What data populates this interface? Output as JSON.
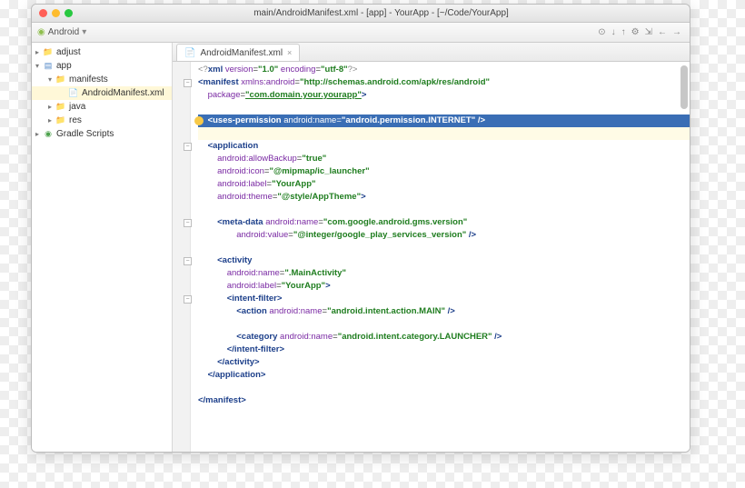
{
  "window": {
    "title": "main/AndroidManifest.xml - [app] - YourApp - [~/Code/YourApp]",
    "traffic": {
      "close": "#ff5f57",
      "min": "#febc2e",
      "max": "#28c840"
    }
  },
  "toolbar": {
    "dropdown_icon": "◉",
    "dropdown_label": "Android",
    "icons": [
      "⊙",
      "↓",
      "↑",
      "⚙",
      "⇲",
      "←",
      "→"
    ]
  },
  "sidebar": {
    "items": [
      {
        "depth": 0,
        "arrow": "▸",
        "icon": "folder",
        "label": "adjust"
      },
      {
        "depth": 0,
        "arrow": "▾",
        "icon": "module",
        "label": "app"
      },
      {
        "depth": 1,
        "arrow": "▾",
        "icon": "folder",
        "label": "manifests"
      },
      {
        "depth": 2,
        "arrow": "",
        "icon": "file",
        "label": "AndroidManifest.xml",
        "selected": true
      },
      {
        "depth": 1,
        "arrow": "▸",
        "icon": "folder",
        "label": "java"
      },
      {
        "depth": 1,
        "arrow": "▸",
        "icon": "folder",
        "label": "res"
      },
      {
        "depth": 0,
        "arrow": "▸",
        "icon": "gradle",
        "label": "Gradle Scripts"
      }
    ]
  },
  "tab": {
    "icon": "📄",
    "label": "AndroidManifest.xml",
    "close": "×"
  },
  "code": {
    "indent": "    ",
    "lines": [
      {
        "t": "pi",
        "content": [
          {
            "c": "pi",
            "x": "<?"
          },
          {
            "c": "tag",
            "x": "xml"
          },
          {
            "c": "",
            "x": " "
          },
          {
            "c": "attr",
            "x": "version"
          },
          {
            "c": "eq",
            "x": "="
          },
          {
            "c": "str",
            "x": "\"1.0\""
          },
          {
            "c": "",
            "x": " "
          },
          {
            "c": "attr",
            "x": "encoding"
          },
          {
            "c": "eq",
            "x": "="
          },
          {
            "c": "str",
            "x": "\"utf-8\""
          },
          {
            "c": "pi",
            "x": "?>"
          }
        ],
        "ind": 0
      },
      {
        "content": [
          {
            "c": "tag",
            "x": "<manifest"
          },
          {
            "c": "",
            "x": " "
          },
          {
            "c": "attr",
            "x": "xmlns:android"
          },
          {
            "c": "eq",
            "x": "="
          },
          {
            "c": "str",
            "x": "\"http://schemas.android.com/apk/res/android\""
          }
        ],
        "ind": 0,
        "fold": true
      },
      {
        "content": [
          {
            "c": "attr",
            "x": "package"
          },
          {
            "c": "eq",
            "x": "="
          },
          {
            "c": "str under",
            "x": "\"com.domain.your.yourapp\""
          },
          {
            "c": "tag",
            "x": ">"
          }
        ],
        "ind": 1
      },
      {
        "blank": true
      },
      {
        "hl": true,
        "bulb": true,
        "content": [
          {
            "c": "tag",
            "x": "<uses-permission"
          },
          {
            "c": "",
            "x": " "
          },
          {
            "c": "attr",
            "x": "android:name"
          },
          {
            "c": "eq",
            "x": "="
          },
          {
            "c": "str",
            "x": "\"android.permission.INTERNET\""
          },
          {
            "c": "tag",
            "x": " />"
          }
        ],
        "ind": 1
      },
      {
        "warn": true,
        "blank": true
      },
      {
        "content": [
          {
            "c": "tag",
            "x": "<application"
          }
        ],
        "ind": 1,
        "fold": true
      },
      {
        "content": [
          {
            "c": "attr",
            "x": "android:allowBackup"
          },
          {
            "c": "eq",
            "x": "="
          },
          {
            "c": "str",
            "x": "\"true\""
          }
        ],
        "ind": 2
      },
      {
        "content": [
          {
            "c": "attr",
            "x": "android:icon"
          },
          {
            "c": "eq",
            "x": "="
          },
          {
            "c": "str",
            "x": "\"@mipmap/ic_launcher\""
          }
        ],
        "ind": 2
      },
      {
        "content": [
          {
            "c": "attr",
            "x": "android:label"
          },
          {
            "c": "eq",
            "x": "="
          },
          {
            "c": "str",
            "x": "\"YourApp\""
          }
        ],
        "ind": 2
      },
      {
        "content": [
          {
            "c": "attr",
            "x": "android:theme"
          },
          {
            "c": "eq",
            "x": "="
          },
          {
            "c": "str",
            "x": "\"@style/AppTheme\""
          },
          {
            "c": "tag",
            "x": ">"
          }
        ],
        "ind": 2
      },
      {
        "blank": true
      },
      {
        "content": [
          {
            "c": "tag",
            "x": "<meta-data"
          },
          {
            "c": "",
            "x": " "
          },
          {
            "c": "attr",
            "x": "android:name"
          },
          {
            "c": "eq",
            "x": "="
          },
          {
            "c": "str",
            "x": "\"com.google.android.gms.version\""
          }
        ],
        "ind": 2,
        "fold": true
      },
      {
        "content": [
          {
            "c": "attr",
            "x": "android:value"
          },
          {
            "c": "eq",
            "x": "="
          },
          {
            "c": "str",
            "x": "\"@integer/google_play_services_version\""
          },
          {
            "c": "tag",
            "x": " />"
          }
        ],
        "ind": 4
      },
      {
        "blank": true
      },
      {
        "content": [
          {
            "c": "tag",
            "x": "<activity"
          }
        ],
        "ind": 2,
        "fold": true
      },
      {
        "content": [
          {
            "c": "attr",
            "x": "android:name"
          },
          {
            "c": "eq",
            "x": "="
          },
          {
            "c": "str",
            "x": "\".MainActivity\""
          }
        ],
        "ind": 3
      },
      {
        "content": [
          {
            "c": "attr",
            "x": "android:label"
          },
          {
            "c": "eq",
            "x": "="
          },
          {
            "c": "str",
            "x": "\"YourApp\""
          },
          {
            "c": "tag",
            "x": ">"
          }
        ],
        "ind": 3
      },
      {
        "content": [
          {
            "c": "tag",
            "x": "<intent-filter>"
          }
        ],
        "ind": 3,
        "fold": true
      },
      {
        "content": [
          {
            "c": "tag",
            "x": "<action"
          },
          {
            "c": "",
            "x": " "
          },
          {
            "c": "attr",
            "x": "android:name"
          },
          {
            "c": "eq",
            "x": "="
          },
          {
            "c": "str",
            "x": "\"android.intent.action.MAIN\""
          },
          {
            "c": "tag",
            "x": " />"
          }
        ],
        "ind": 4
      },
      {
        "blank": true
      },
      {
        "content": [
          {
            "c": "tag",
            "x": "<category"
          },
          {
            "c": "",
            "x": " "
          },
          {
            "c": "attr",
            "x": "android:name"
          },
          {
            "c": "eq",
            "x": "="
          },
          {
            "c": "str",
            "x": "\"android.intent.category.LAUNCHER\""
          },
          {
            "c": "tag",
            "x": " />"
          }
        ],
        "ind": 4
      },
      {
        "content": [
          {
            "c": "tag",
            "x": "</intent-filter>"
          }
        ],
        "ind": 3
      },
      {
        "content": [
          {
            "c": "tag",
            "x": "</activity>"
          }
        ],
        "ind": 2
      },
      {
        "content": [
          {
            "c": "tag",
            "x": "</application>"
          }
        ],
        "ind": 1
      },
      {
        "blank": true
      },
      {
        "content": [
          {
            "c": "tag",
            "x": "</manifest>"
          }
        ],
        "ind": 0
      }
    ]
  }
}
